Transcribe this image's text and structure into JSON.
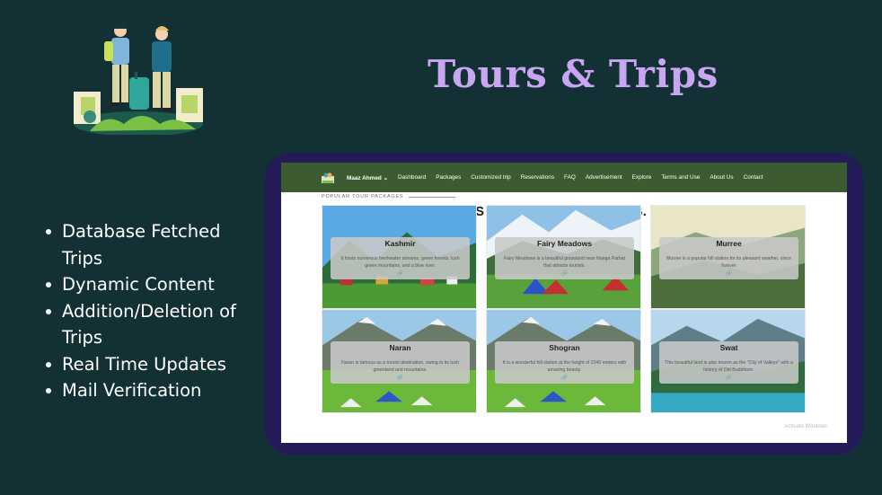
{
  "slide": {
    "title": "Tours & Trips",
    "bullets": [
      "Database Fetched Trips",
      "Dynamic Content",
      "Addition/Deletion of Trips",
      "Real Time Updates",
      "Mail Verification"
    ]
  },
  "site": {
    "nav": {
      "user": "Maaz Ahmed ⌄",
      "items": [
        "Dashboard",
        "Packages",
        "Customized trip",
        "Reservations",
        "FAQ",
        "Advertisement",
        "Explore",
        "Terms and Use",
        "About Us",
        "Contact"
      ]
    },
    "eyebrow": "POPULAR TOUR PACKAGES",
    "heading": "MAKE YOUR VACATIONS WORTHWHILE WITH US.",
    "cards": [
      {
        "title": "Kashmir",
        "desc": "It hosts numerous freshwater streams, green forests, lush green mountains, and a blue river.",
        "link": "🔗"
      },
      {
        "title": "Fairy Meadows",
        "desc": "Fairy Meadows is a beautiful grassland near Nanga Parbat that attracts tourists.",
        "link": "🔗"
      },
      {
        "title": "Murree",
        "desc": "Murree is a popular hill station,for its pleasant weather, since forever",
        "link": "🔗"
      },
      {
        "title": "Naran",
        "desc": "Naran is famous as a tourist destination, owing to its lush greenland and mountains.",
        "link": "🔗"
      },
      {
        "title": "Shogran",
        "desc": "It is a wonderful hill station at the height of 2340 meters with amazing beauty.",
        "link": "🔗"
      },
      {
        "title": "Swat",
        "desc": "This beautiful land is also known as the \"City of Valleys\" with a history of Old Buddhism.",
        "link": "🔗"
      }
    ],
    "watermark": "Activate Windows"
  },
  "colors": {
    "background": "#133134",
    "title": "#c9a6f2",
    "frame": "#221b57",
    "site_nav": "#3e5a31"
  }
}
